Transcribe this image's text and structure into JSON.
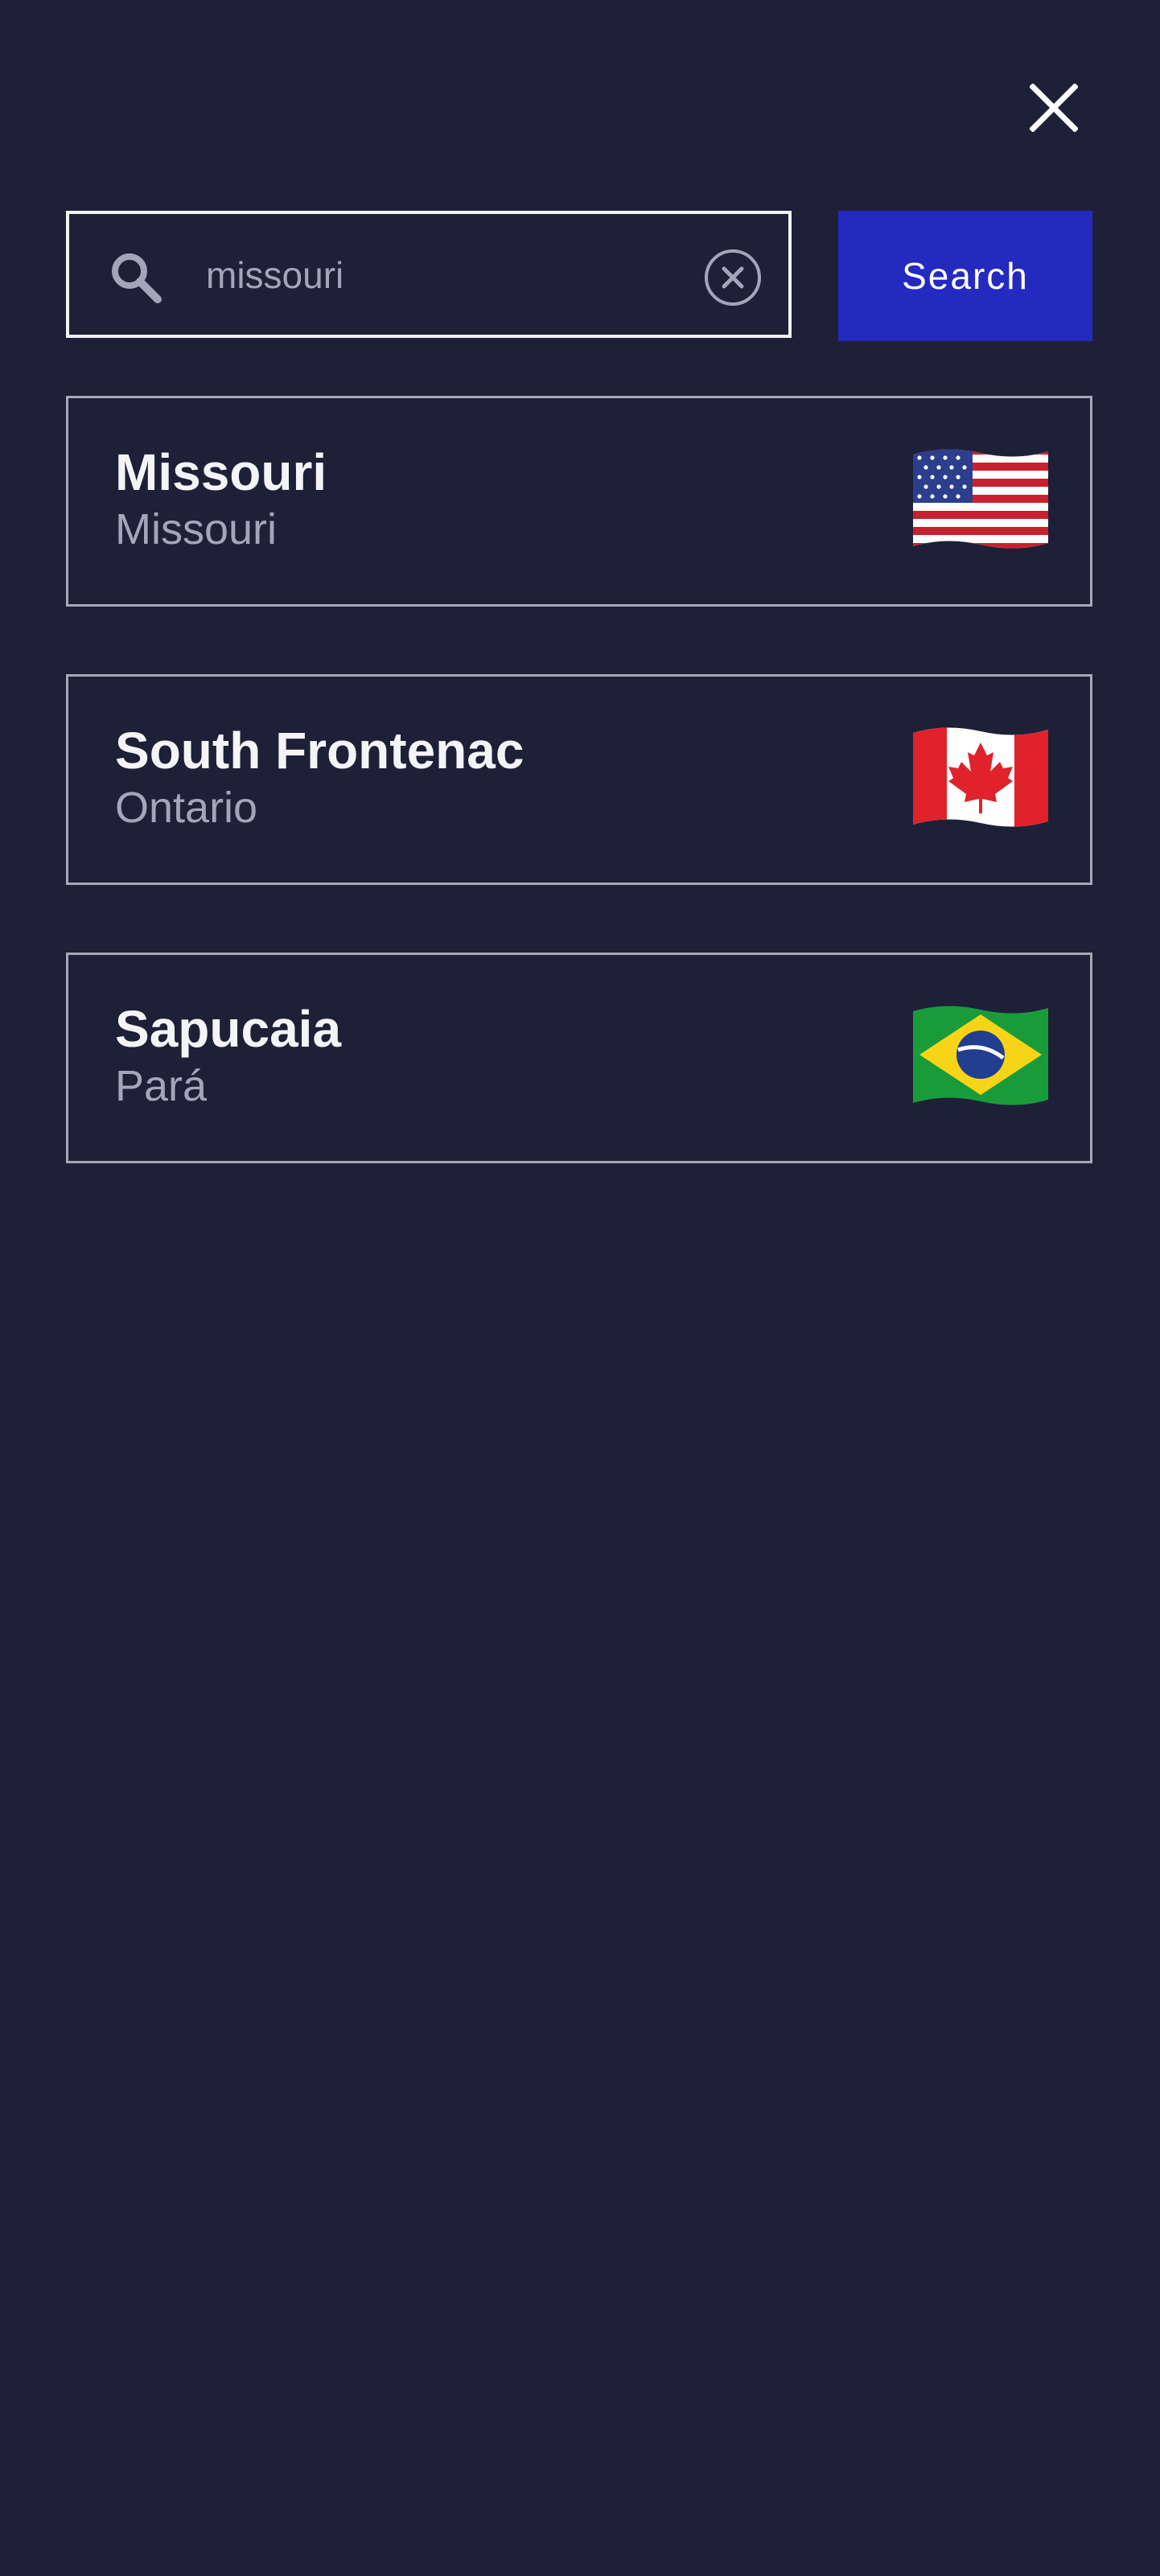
{
  "header": {
    "close_icon": "close-icon"
  },
  "search": {
    "value": "missouri",
    "search_icon": "search-icon",
    "clear_icon": "clear-circle-x-icon",
    "button_label": "Search"
  },
  "results": [
    {
      "name": "Missouri",
      "region": "Missouri",
      "flag_icon": "us-flag-icon"
    },
    {
      "name": "South Frontenac",
      "region": "Ontario",
      "flag_icon": "canada-flag-icon"
    },
    {
      "name": "Sapucaia",
      "region": "Pará",
      "flag_icon": "brazil-flag-icon"
    }
  ],
  "colors": {
    "background": "#1e2038",
    "accent": "#2429bf",
    "text_primary": "#f4f4f7",
    "text_secondary": "#a3a5b8",
    "border": "#a6a8b8"
  }
}
